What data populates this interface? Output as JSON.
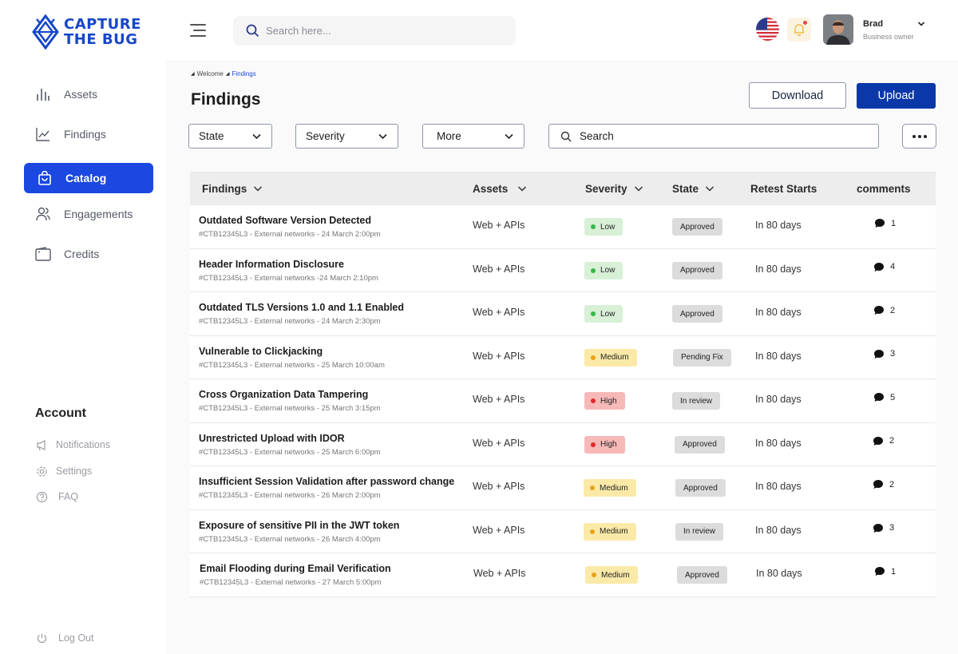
{
  "logo": {
    "line1": "CAPTURE",
    "line2": "THE BUG"
  },
  "sidebar": {
    "items": [
      {
        "label": "Assets",
        "icon": "bar-chart-icon"
      },
      {
        "label": "Findings",
        "icon": "line-chart-icon"
      },
      {
        "label": "Catalog",
        "icon": "bag-icon",
        "active": true
      },
      {
        "label": "Engagements",
        "icon": "users-icon"
      },
      {
        "label": "Credits",
        "icon": "wallet-icon"
      }
    ],
    "account_title": "Account",
    "account_items": [
      {
        "label": "Notifications",
        "icon": "megaphone-icon"
      },
      {
        "label": "Settings",
        "icon": "gear-icon"
      },
      {
        "label": "FAQ",
        "icon": "help-icon"
      }
    ],
    "logout_label": "Log Out"
  },
  "header": {
    "search_placeholder": "Search here...",
    "user": {
      "name": "Brad",
      "role": "Business owner"
    }
  },
  "breadcrumb": {
    "items": [
      "Welcome",
      "Findings"
    ]
  },
  "page": {
    "title": "Findings",
    "download_label": "Download",
    "upload_label": "Upload"
  },
  "filters": {
    "state": "State",
    "severity": "Severity",
    "more": "More",
    "search_placeholder": "Search"
  },
  "table": {
    "columns": {
      "findings": "Findings",
      "assets": "Assets",
      "severity": "Severity",
      "state": "State",
      "retest": "Retest Starts",
      "comments": "comments"
    },
    "rows": [
      {
        "title": "Outdated Software Version Detected",
        "meta": "#CTB12345L3  -  External networks - 24 March 2:00pm",
        "asset": "Web + APIs",
        "severity": "Low",
        "state": "Approved",
        "retest": "In 80 days",
        "comments": "1"
      },
      {
        "title": "Header Information Disclosure",
        "meta": "#CTB12345L3  -  External networks -24 March 2:10pm",
        "asset": "Web + APIs",
        "severity": "Low",
        "state": "Approved",
        "retest": "In 80 days",
        "comments": "4"
      },
      {
        "title": "Outdated TLS Versions 1.0 and 1.1 Enabled",
        "meta": "#CTB12345L3  -  External networks - 24 March 2:30pm",
        "asset": "Web + APIs",
        "severity": "Low",
        "state": "Approved",
        "retest": "In 80 days",
        "comments": "2"
      },
      {
        "title": "Vulnerable to Clickjacking",
        "meta": "#CTB12345L3  -  External networks - 25 March 10:00am",
        "asset": "Web + APIs",
        "severity": "Medium",
        "state": "Pending Fix",
        "retest": "In 80 days",
        "comments": "3"
      },
      {
        "title": "Cross Organization Data Tampering",
        "meta": "#CTB12345L3  -  External networks - 25 March 3:15pm",
        "asset": "Web + APIs",
        "severity": "High",
        "state": "In review",
        "retest": "In 80 days",
        "comments": "5"
      },
      {
        "title": "Unrestricted Upload with IDOR",
        "meta": "#CTB12345L3  -  External networks - 25 March 6:00pm",
        "asset": "Web + APIs",
        "severity": "High",
        "state": "Approved",
        "retest": "In 80 days",
        "comments": "2"
      },
      {
        "title": "Insufficient Session Validation after password change",
        "meta": "#CTB12345L3  -  External networks - 26 March 2:00pm",
        "asset": "Web + APIs",
        "severity": "Medium",
        "state": "Approved",
        "retest": "In 80 days",
        "comments": "2"
      },
      {
        "title": "Exposure of sensitive PII in the JWT token",
        "meta": "#CTB12345L3  -  External networks - 26 March 4:00pm",
        "asset": "Web + APIs",
        "severity": "Medium",
        "state": "In review",
        "retest": "In 80 days",
        "comments": "3"
      },
      {
        "title": "Email Flooding during Email Verification",
        "meta": "#CTB12345L3  -  External networks - 27 March 5:00pm",
        "asset": "Web + APIs",
        "severity": "Medium",
        "state": "Approved",
        "retest": "In 80 days",
        "comments": "1"
      }
    ]
  },
  "colors": {
    "accent": "#1a48e0",
    "upload": "#0a38a8",
    "low": "#3bb54a",
    "medium": "#e8a21a",
    "high": "#e02a2a"
  }
}
